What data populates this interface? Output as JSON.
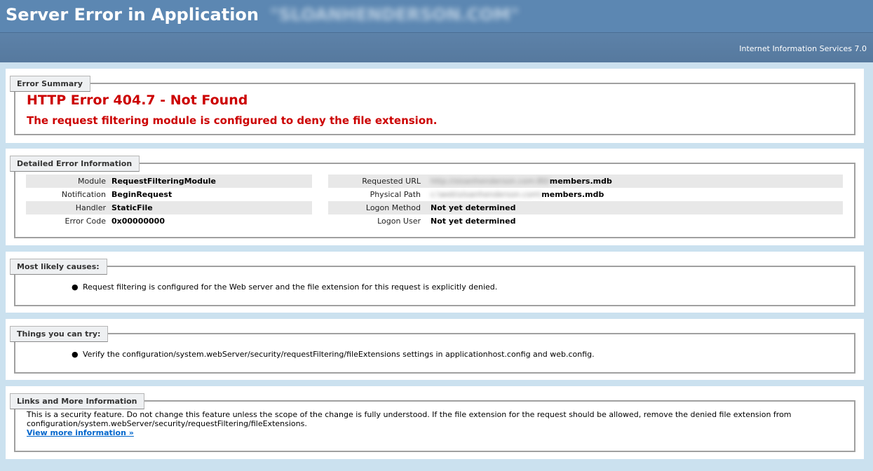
{
  "header": {
    "title": "Server Error in Application",
    "host_redacted": "\"SLOANHENDERSON.COM\"",
    "iis_version": "Internet Information Services 7.0"
  },
  "error_summary": {
    "legend": "Error Summary",
    "title": "HTTP Error 404.7 - Not Found",
    "subtitle": "The request filtering module is configured to deny the file extension."
  },
  "detailed_info": {
    "legend": "Detailed Error Information",
    "left": [
      {
        "label": "Module",
        "value": "RequestFilteringModule"
      },
      {
        "label": "Notification",
        "value": "BeginRequest"
      },
      {
        "label": "Handler",
        "value": "StaticFile"
      },
      {
        "label": "Error Code",
        "value": "0x00000000"
      }
    ],
    "right": [
      {
        "label": "Requested URL",
        "redacted": "http://sloanhenderson.com:80/",
        "value": "members.mdb"
      },
      {
        "label": "Physical Path",
        "redacted": "c:\\web\\sloanhenderson.com\\",
        "value": "members.mdb"
      },
      {
        "label": "Logon Method",
        "redacted": "",
        "value": "Not yet determined"
      },
      {
        "label": "Logon User",
        "redacted": "",
        "value": "Not yet determined"
      }
    ]
  },
  "causes": {
    "legend": "Most likely causes:",
    "items": [
      "Request filtering is configured for the Web server and the file extension for this request is explicitly denied."
    ]
  },
  "try": {
    "legend": "Things you can try:",
    "items": [
      "Verify the configuration/system.webServer/security/requestFiltering/fileExtensions settings in applicationhost.config and web.config."
    ]
  },
  "links": {
    "legend": "Links and More Information",
    "text": "This is a security feature. Do not change this feature unless the scope of the change is fully understood. If the file extension for the request should be allowed, remove the denied file extension from configuration/system.webServer/security/requestFiltering/fileExtensions.",
    "link_label": "View more information »"
  }
}
